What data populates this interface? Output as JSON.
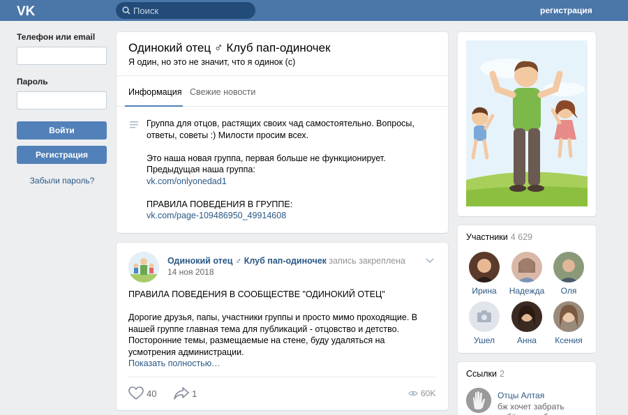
{
  "header": {
    "logo_icon": "vk-logo-icon",
    "search_placeholder": "Поиск",
    "register_link": "регистрация"
  },
  "login": {
    "phone_label": "Телефон или email",
    "password_label": "Пароль",
    "login_button": "Войти",
    "register_button": "Регистрация",
    "forgot_link": "Забыли пароль?"
  },
  "group": {
    "title": "Одинокий отец ♂ Клуб пап-одиночек",
    "status": "Я один, но это не значит, что я одинок (с)",
    "tabs": [
      {
        "label": "Информация",
        "active": true
      },
      {
        "label": "Свежие новости",
        "active": false
      }
    ],
    "description": {
      "line1": "Группа для отцов, растящих своих чад самостоятельно. Вопросы, ответы, советы :) Милости просим всех.",
      "line2": "Это наша новая группа, первая больше не функционирует.",
      "line3": "Предыдущая наша группа:",
      "link1": "vk.com/onlyonedad1",
      "line4": "ПРАВИЛА ПОВЕДЕНИЯ В ГРУППЕ:",
      "link2": "vk.com/page-109486950_49914608"
    }
  },
  "post": {
    "author": "Одинокий отец ♂ Клуб пап-одиночек",
    "pinned": "запись закреплена",
    "date": "14 ноя 2018",
    "heading": "ПРАВИЛА ПОВЕДЕНИЯ В СООБЩЕСТВЕ \"ОДИНОКИЙ ОТЕЦ\"",
    "body": "Дорогие друзья, папы, участники группы и просто мимо проходящие. В нашей группе главная тема для публикаций - отцовство и детство. Посторонние темы, размещаемые на стене, буду удаляться на усмотрения администрации.",
    "show_more": "Показать полностью…",
    "likes": "40",
    "shares": "1",
    "views": "60K"
  },
  "members": {
    "title": "Участники",
    "count": "4 629",
    "list": [
      {
        "name": "Ирина",
        "color": "#6b4a3a"
      },
      {
        "name": "Надежда",
        "color": "#c79a86"
      },
      {
        "name": "Оля",
        "color": "#7d8a6a"
      },
      {
        "name": "Ушел",
        "color": "#d3d9de"
      },
      {
        "name": "Анна",
        "color": "#4a3426"
      },
      {
        "name": "Ксения",
        "color": "#8a6b5a"
      }
    ]
  },
  "links": {
    "title": "Ссылки",
    "count": "2",
    "item_title": "Отцы Алтая",
    "item_desc": "бж хочет забрать ребёнка не бог"
  },
  "colors": {
    "header_bg": "#4a76a8",
    "button_bg": "#5181b8",
    "link": "#2a5885",
    "page_bg": "#edeef0"
  }
}
